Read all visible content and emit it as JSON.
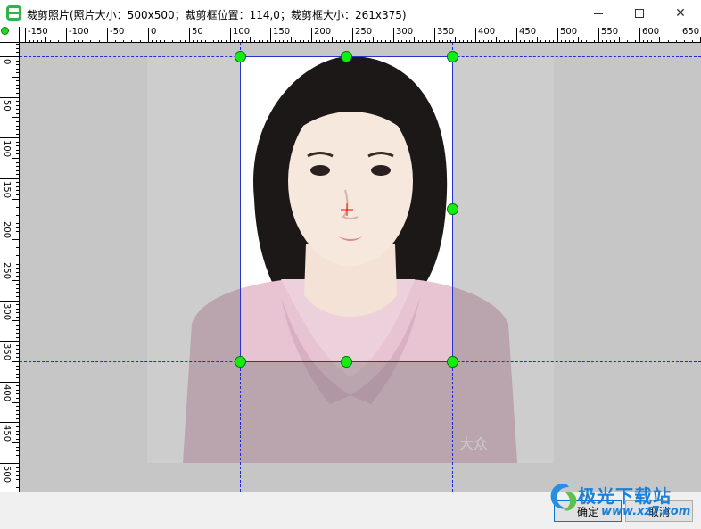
{
  "window": {
    "title": "裁剪照片(照片大小：500x500；裁剪框位置：114,0；裁剪框大小：261x375)",
    "close_glyph": "✕"
  },
  "rulers": {
    "horizontal_labels": [
      "-150",
      "-100",
      "-50",
      "0",
      "50",
      "100",
      "150",
      "200",
      "250",
      "300",
      "350",
      "400",
      "450",
      "500",
      "550",
      "600",
      "650"
    ],
    "vertical_labels": [
      "0",
      "50",
      "100",
      "150",
      "200",
      "250",
      "300",
      "350",
      "400",
      "450",
      "500"
    ]
  },
  "photo": {
    "watermark_text": "大众"
  },
  "buttons": {
    "ok_label": "确定",
    "cancel_label": "取消"
  },
  "site_watermark": {
    "name": "极光下载站",
    "url": "www.xz7.com"
  },
  "colors": {
    "handle": "#12ee12",
    "guide": "#1f2bd6",
    "crop_border": "#2732c9",
    "center_mark": "#ff0000",
    "shirt": "#dcbccb",
    "hair": "#1c1818"
  },
  "icons": [
    "app-icon",
    "minimize-icon",
    "maximize-icon",
    "close-icon",
    "ruler-origin-icon",
    "crop-handle",
    "center-crosshair-icon"
  ]
}
